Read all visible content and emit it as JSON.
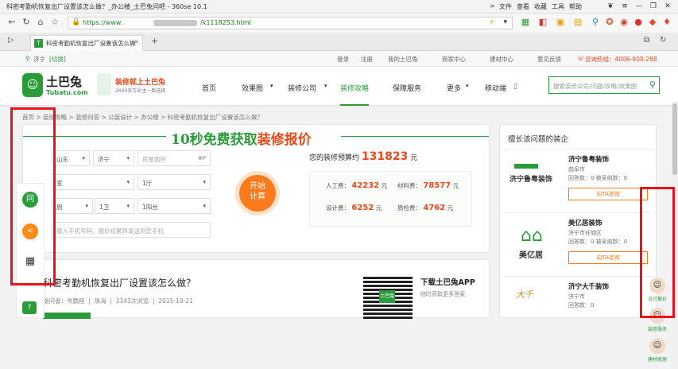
{
  "browser": {
    "title": "科密考勤机恢复出厂设置该怎么做？_办公楼_土巴兔问吧 - 360se 10.1",
    "menu": [
      "文件",
      "查看",
      "收藏",
      "工具",
      "帮助"
    ],
    "url_prefix": "https://www.",
    "url_suffix": "/k1118253.html",
    "tab_title": "科密考勤机恢复出厂设置该怎么做",
    "tab_close": "×",
    "new_tab": "+"
  },
  "topbar": {
    "city": "济宁",
    "switch": "[切换]",
    "links": [
      "登录",
      "注册",
      "我的土巴兔",
      "商家中心",
      "建材中心",
      "意见反馈"
    ],
    "hotline": "咨询热线：4006-900-288"
  },
  "header": {
    "logo_name": "土巴兔",
    "logo_domain": "Tubatu.com",
    "slogan": "装修就上土巴兔",
    "slogan_sub": "2600多万业主一致选择",
    "nav": [
      "首页",
      "效果图",
      "装修公司",
      "装修攻略",
      "保障服务",
      "更多",
      "移动端"
    ],
    "search_placeholder": "搜索装修公司/问题/攻略/效果图"
  },
  "breadcrumb": "首页 > 装修攻略 > 装修问答 > 公装设计 > 办公楼 > 科密考勤机恢复出厂设置该怎么做？",
  "calculator": {
    "title_green": "10秒免费获取",
    "title_red": "装修报价",
    "province": "山东",
    "city": "济宁",
    "area_placeholder": "房屋面积",
    "area_unit": "m²",
    "room": "室",
    "hall": "1厅",
    "kitchen": "厨",
    "bath": "1卫",
    "balcony": "1阳台",
    "phone_placeholder": "输入手机号码，报价结果将发送到您手机",
    "start_line1": "开始",
    "start_line2": "计算",
    "budget_label": "您的装修预算约",
    "budget_value": "131823",
    "budget_unit": "元",
    "labor_label": "人工费：",
    "labor_value": "42232",
    "material_label": "材料费：",
    "material_value": "78577",
    "design_label": "设计费：",
    "design_value": "6252",
    "qc_label": "质检费：",
    "qc_value": "4762",
    "yuan": "元"
  },
  "question": {
    "title": "科密考勤机恢复出厂设置该怎么做？",
    "asker": "提问者：岑鹏程",
    "place": "珠海",
    "views": "3343次浏览",
    "date": "2015-10-21",
    "app_title": "下载土巴兔APP",
    "app_sub": "随时获取更多答案",
    "qr_label": "土巴兔"
  },
  "right_panel": {
    "heading": "擅长该问题的装企",
    "companies": [
      {
        "logo": "济宁鲁粤装饰",
        "name": "济宁鲁粤装饰",
        "city": "曲阜市",
        "stats": "回答数：0  被采纳数：0",
        "button": "向TA咨询"
      },
      {
        "logo": "美亿居",
        "name": "美亿居装饰",
        "city": "济宁市任城区",
        "stats": "回答数：0  被采纳数：0",
        "button": "向TA咨询"
      },
      {
        "logo": "大千",
        "name": "济宁大千装饰",
        "city": "济宁市",
        "stats": "回答数：0",
        "button": ""
      }
    ]
  },
  "float_right": [
    "设计报价",
    "装修服务",
    "建材家居"
  ],
  "left_bar": [
    "问",
    "分享",
    "二维码",
    "?"
  ],
  "colors": {
    "brand": "#2a9d3a",
    "accent": "#e8491d",
    "annotation": "#e8141b"
  }
}
